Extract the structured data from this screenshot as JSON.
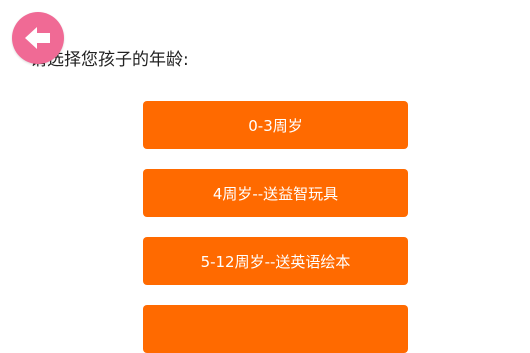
{
  "header": {
    "back_icon": "back-arrow-icon",
    "back_color": "#f06a95"
  },
  "prompt": {
    "text": "请选择您孩子的年龄:"
  },
  "options": [
    {
      "label": "0-3周岁"
    },
    {
      "label": "4周岁--送益智玩具"
    },
    {
      "label": "5-12周岁--送英语绘本"
    },
    {
      "label": ""
    }
  ],
  "colors": {
    "accent": "#ff6a00",
    "text": "#222222",
    "button_text": "#ffffff"
  }
}
